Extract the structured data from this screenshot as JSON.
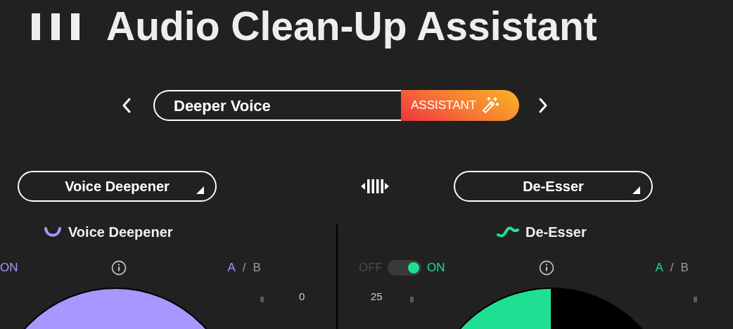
{
  "title": "Audio Clean-Up Assistant",
  "preset": {
    "name": "Deeper Voice",
    "assistant_label": "ASSISTANT"
  },
  "modules": [
    {
      "dropdown": "Voice Deepener",
      "title": "Voice Deepener",
      "kind": "curve",
      "color": "#a996ff",
      "toggle": {
        "on": true,
        "on_label": "ON"
      },
      "ab": [
        {
          "kind": "option",
          "label": "A",
          "selected": true
        },
        {
          "label": "/",
          "kind": "separator"
        },
        {
          "kind": "option",
          "label": "B",
          "selected": false
        }
      ],
      "knob": {
        "scale_max": "0"
      }
    },
    {
      "dropdown": "De-Esser",
      "title": "De-Esser",
      "kind": "wave",
      "color": "#1fe092",
      "toggle": {
        "on": true,
        "on_label": "ON",
        "off_label": "OFF"
      },
      "ab": [
        {
          "kind": "option",
          "label": "A",
          "selected": true
        },
        {
          "label": "/",
          "kind": "separator"
        },
        {
          "kind": "option",
          "label": "B",
          "selected": false
        }
      ],
      "knob": {
        "scale_min": "25"
      }
    }
  ]
}
